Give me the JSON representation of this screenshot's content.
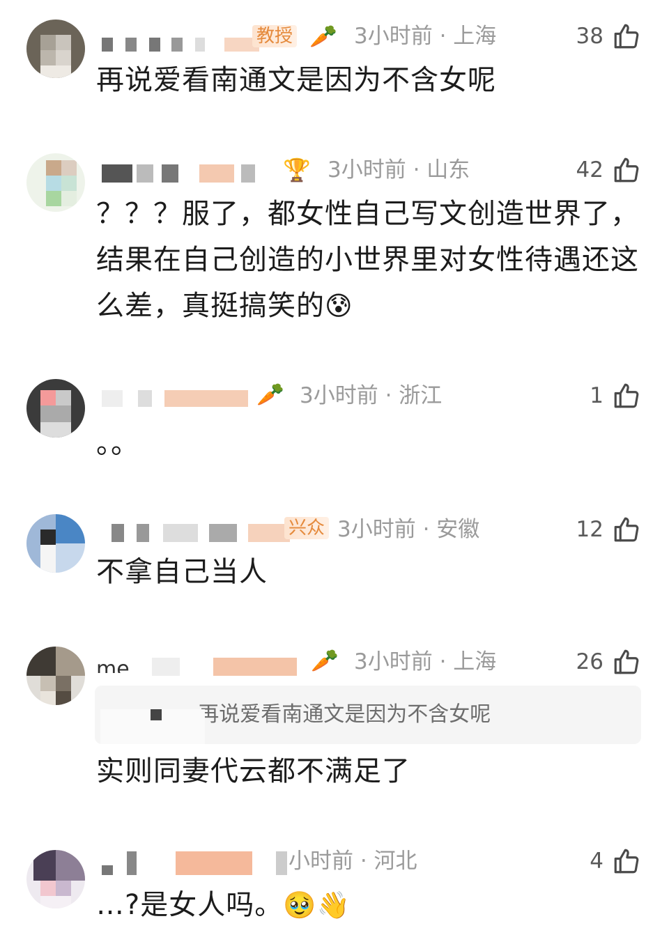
{
  "comments": [
    {
      "badge": "教授",
      "badge_icon": "🥕",
      "meta": "3小时前 · 上海",
      "likes": "38",
      "text": "再说爱看南通文是因为不含女呢"
    },
    {
      "badge_icon": "🏆",
      "meta": "3小时前 · 山东",
      "likes": "42",
      "text": "？？？服了，都女性自己写文创造世界了，结果在自己创造的小世界里对女性待遇还这么差，真挺搞笑的",
      "emoji": "😰"
    },
    {
      "badge_icon": "🥕",
      "meta": "3小时前 · 浙江",
      "likes": "1",
      "text": "。。"
    },
    {
      "badge": "兴众",
      "meta": "3小时前 · 安徽",
      "likes": "12",
      "text": "不拿自己当人"
    },
    {
      "name_fragment": "me.",
      "badge_icon": "🥕",
      "meta": "3小时前 · 上海",
      "likes": "26",
      "quote": "oer: 再说爱看南通文是因为不含女呢",
      "text": "实则同妻代云都不满足了"
    },
    {
      "meta": "小时前 · 河北",
      "likes": "4",
      "text": "…?是女人吗。",
      "emoji": "🥹👋"
    }
  ],
  "icons": {
    "like": "thumbs-up-icon"
  },
  "colors": {
    "meta": "#9a9a9a",
    "text": "#1c1c1c",
    "badge": "#e58a3c",
    "quote_bg": "#f5f5f5"
  }
}
